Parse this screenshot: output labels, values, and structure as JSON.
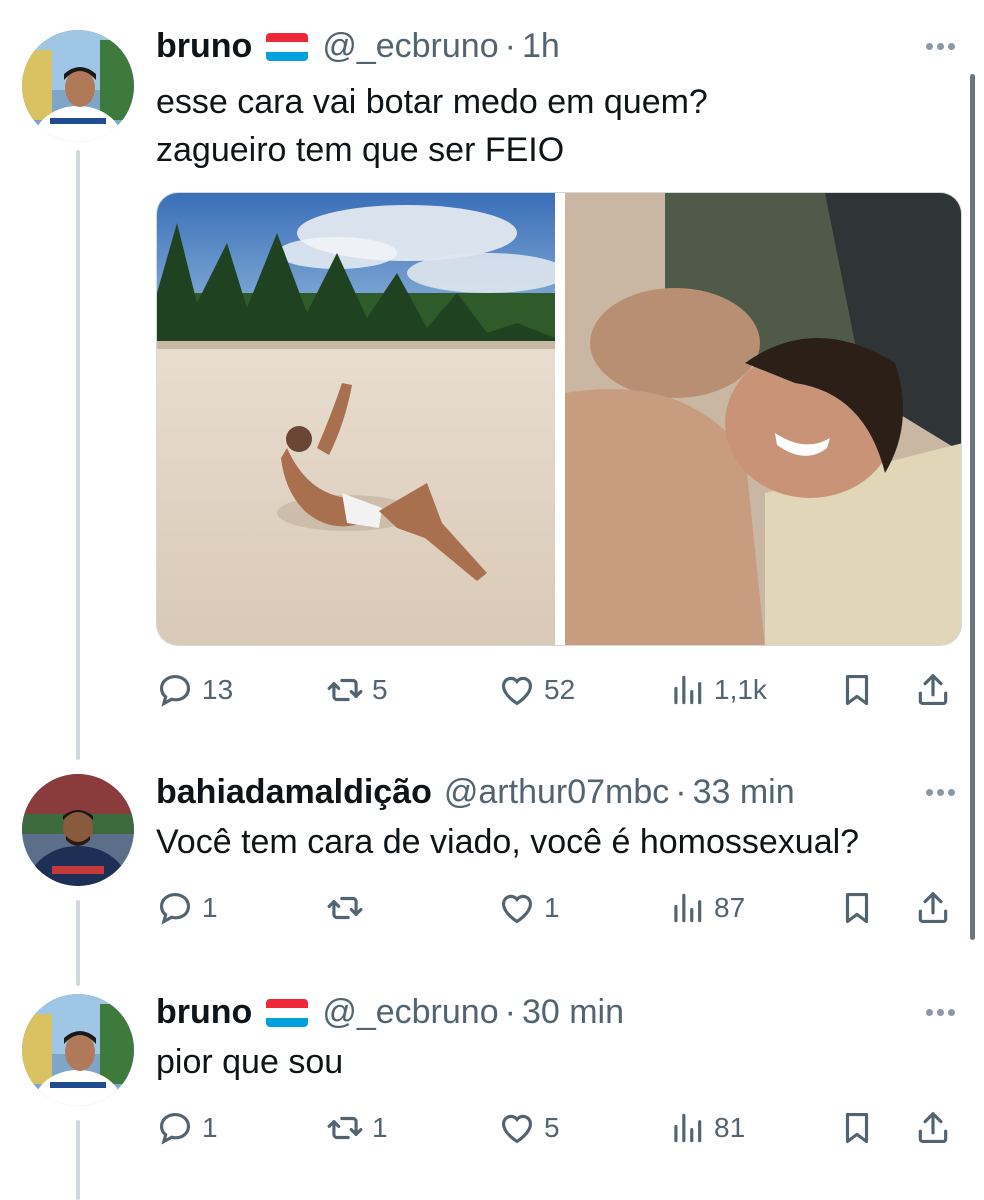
{
  "tweets": [
    {
      "name": "bruno",
      "handle": "@_ecbruno",
      "separator": "·",
      "time": "1h",
      "lines": [
        "esse cara vai botar medo em quem?",
        "zagueiro tem que ser FEIO"
      ],
      "replies": "13",
      "retweets": "5",
      "likes": "52",
      "views": "1,1k"
    },
    {
      "name": "bahiadamaldição",
      "handle": "@arthur07mbc",
      "separator": "·",
      "time": "33 min",
      "lines": [
        "Você tem cara de viado, você é homossexual?"
      ],
      "replies": "1",
      "retweets": "",
      "likes": "1",
      "views": "87"
    },
    {
      "name": "bruno",
      "handle": "@_ecbruno",
      "separator": "·",
      "time": "30 min",
      "lines": [
        "pior que sou"
      ],
      "replies": "1",
      "retweets": "1",
      "likes": "5",
      "views": "81"
    }
  ],
  "icons": {
    "reply": "reply-icon",
    "retweet": "retweet-icon",
    "like": "heart-icon",
    "views": "views-icon",
    "bookmark": "bookmark-icon",
    "share": "share-icon",
    "more": "more-icon",
    "flag": "luxembourg-flag-icon"
  },
  "colors": {
    "text": "#0f1419",
    "secondary": "#536471",
    "thread_line": "#cfd9de",
    "flag_red": "#ed2939",
    "flag_white": "#ffffff",
    "flag_blue": "#00a1de"
  }
}
